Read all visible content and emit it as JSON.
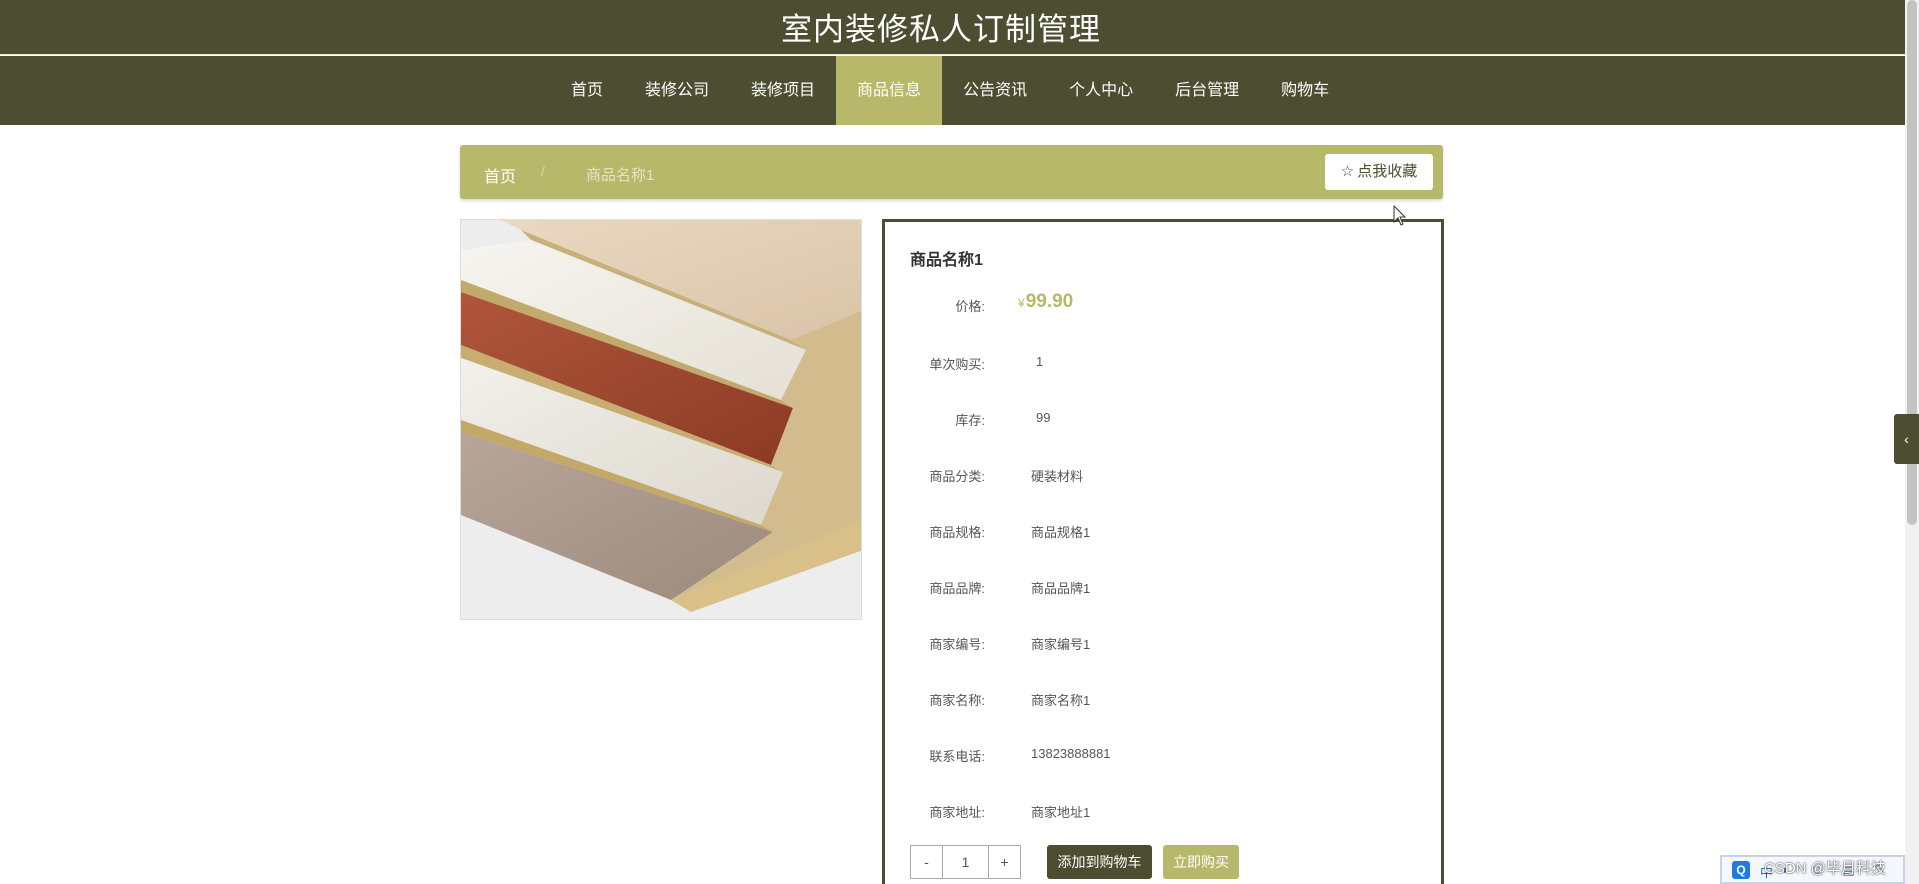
{
  "site": {
    "title": "室内装修私人订制管理"
  },
  "nav": {
    "items": [
      {
        "label": "首页"
      },
      {
        "label": "装修公司"
      },
      {
        "label": "装修项目"
      },
      {
        "label": "商品信息"
      },
      {
        "label": "公告资讯"
      },
      {
        "label": "个人中心"
      },
      {
        "label": "后台管理"
      },
      {
        "label": "购物车"
      }
    ],
    "active_index": 3
  },
  "breadcrumb": {
    "home": "首页",
    "separator": "/",
    "current": "商品名称1"
  },
  "favorite_button": {
    "label": "点我收藏",
    "icon": "star-icon"
  },
  "product": {
    "name": "商品名称1",
    "price_label": "价格:",
    "currency": "¥",
    "price": "99.90",
    "fields": [
      {
        "label": "单次购买:",
        "value": "1"
      },
      {
        "label": "库存:",
        "value": "99"
      },
      {
        "label": "商品分类:",
        "value": "硬装材料"
      },
      {
        "label": "商品规格:",
        "value": "商品规格1"
      },
      {
        "label": "商品品牌:",
        "value": "商品品牌1"
      },
      {
        "label": "商家编号:",
        "value": "商家编号1"
      },
      {
        "label": "商家名称:",
        "value": "商家名称1"
      },
      {
        "label": "联系电话:",
        "value": "13823888881"
      },
      {
        "label": "商家地址:",
        "value": "商家地址1"
      }
    ],
    "image": "wall-panel-photo"
  },
  "quantity": {
    "minus": "-",
    "value": "1",
    "plus": "+"
  },
  "actions": {
    "add_to_cart": "添加到购物车",
    "buy_now": "立即购买"
  },
  "side_tab": {
    "icon": "chevron-left-icon",
    "glyph": "‹"
  },
  "tray": {
    "q_icon": "Q",
    "ime": "中"
  },
  "watermark": "CSDN @毕月科技",
  "colors": {
    "primary": "#4d4d31",
    "accent": "#b8b86a"
  }
}
